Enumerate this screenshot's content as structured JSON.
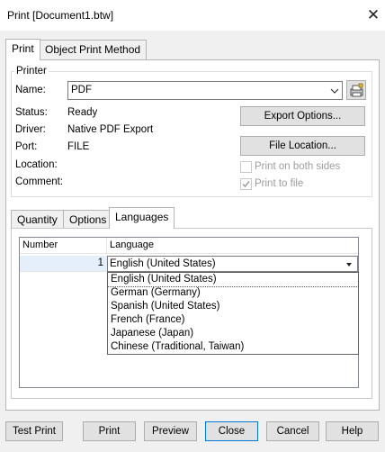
{
  "window": {
    "title": "Print [Document1.btw]",
    "close_glyph": "✕"
  },
  "main_tabs": [
    {
      "label": "Print"
    },
    {
      "label": "Object Print Method"
    }
  ],
  "printer": {
    "group_label": "Printer",
    "name_label": "Name:",
    "name_value": "PDF",
    "status_label": "Status:",
    "status_value": "Ready",
    "driver_label": "Driver:",
    "driver_value": "Native PDF Export",
    "port_label": "Port:",
    "port_value": "FILE",
    "location_label": "Location:",
    "comment_label": "Comment:",
    "export_options_label": "Export Options...",
    "file_location_label": "File Location...",
    "print_both_sides_label": "Print on both sides",
    "print_to_file_label": "Print to file",
    "print_to_file_checked": true
  },
  "sub_tabs": [
    {
      "label": "Quantity"
    },
    {
      "label": "Options"
    },
    {
      "label": "Languages"
    }
  ],
  "languages_grid": {
    "columns": [
      "Number",
      "Language"
    ],
    "rows": [
      {
        "number": "1",
        "language": "English (United States)"
      }
    ],
    "dropdown_options": [
      "English (United States)",
      "German (Germany)",
      "Spanish (United States)",
      "French (France)",
      "Japanese (Japan)",
      "Chinese (Traditional, Taiwan)"
    ]
  },
  "buttons": {
    "test_print": "Test Print",
    "print": "Print",
    "preview": "Preview",
    "close": "Close",
    "cancel": "Cancel",
    "help": "Help"
  },
  "colors": {
    "selected_row": "#e5eefb",
    "focus": "#0078d7"
  }
}
